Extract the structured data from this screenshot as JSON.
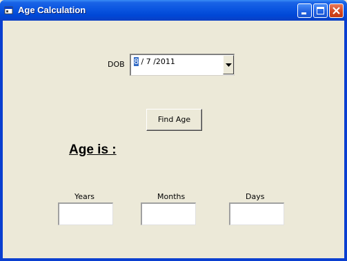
{
  "window": {
    "title": "Age Calculation"
  },
  "form": {
    "dob_label": "DOB",
    "dob_selected_part": "8",
    "dob_rest": " / 7 /2011",
    "find_button": "Find Age",
    "age_heading": "Age is :",
    "years_label": "Years",
    "months_label": "Months",
    "days_label": "Days",
    "years_value": "",
    "months_value": "",
    "days_value": ""
  },
  "icons": {
    "app": "form-icon",
    "minimize": "minimize-icon",
    "maximize": "maximize-icon",
    "close": "close-icon",
    "dropdown": "chevron-down-icon"
  },
  "colors": {
    "titlebar": "#0a55e0",
    "background": "#ece9d8",
    "selection": "#316ac5",
    "close_button": "#d2451f"
  }
}
